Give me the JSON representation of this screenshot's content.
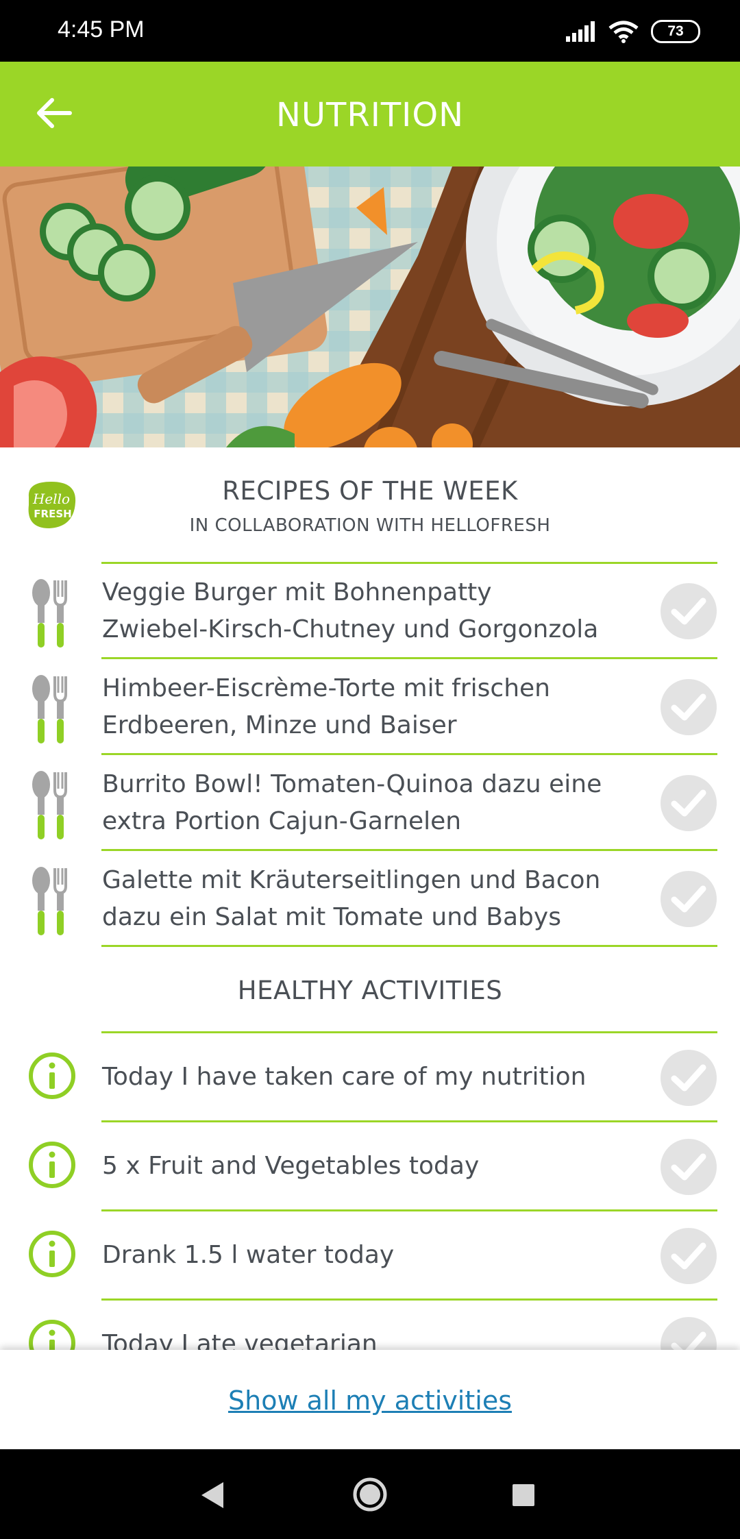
{
  "status_bar": {
    "time": "4:45 PM",
    "battery": "73"
  },
  "header": {
    "title": "NUTRITION"
  },
  "recipes": {
    "logo_text_1": "Hello",
    "logo_text_2": "FRESH",
    "title": "RECIPES OF THE WEEK",
    "subtitle": "IN COLLABORATION WITH HELLOFRESH",
    "items": [
      {
        "line1": "Veggie Burger mit Bohnenpatty",
        "line2": "Zwiebel-Kirsch-Chutney und Gorgonzola"
      },
      {
        "line1": "Himbeer-Eiscrème-Torte mit frischen",
        "line2": "Erdbeeren, Minze und Baiser"
      },
      {
        "line1": "Burrito Bowl! Tomaten-Quinoa dazu eine",
        "line2": "extra Portion Cajun-Garnelen"
      },
      {
        "line1": "Galette mit Kräuterseitlingen und Bacon",
        "line2": "dazu ein Salat mit Tomate und Babys"
      }
    ]
  },
  "activities": {
    "title": "HEALTHY ACTIVITIES",
    "items": [
      {
        "label": "Today I have taken care of my nutrition"
      },
      {
        "label": "5 x Fruit and Vegetables today"
      },
      {
        "label": "Drank 1.5 l water today"
      },
      {
        "label": "Today I ate vegetarian"
      }
    ]
  },
  "footer": {
    "show_all_label": "Show all my activities"
  },
  "colors": {
    "accent": "#9bd627",
    "text": "#4a4f55",
    "link": "#1d7fb5",
    "check_bg": "#e3e3e3"
  },
  "icons": [
    "back-arrow-icon",
    "cutlery-icon",
    "info-icon",
    "checkmark-icon",
    "hellofresh-logo"
  ]
}
